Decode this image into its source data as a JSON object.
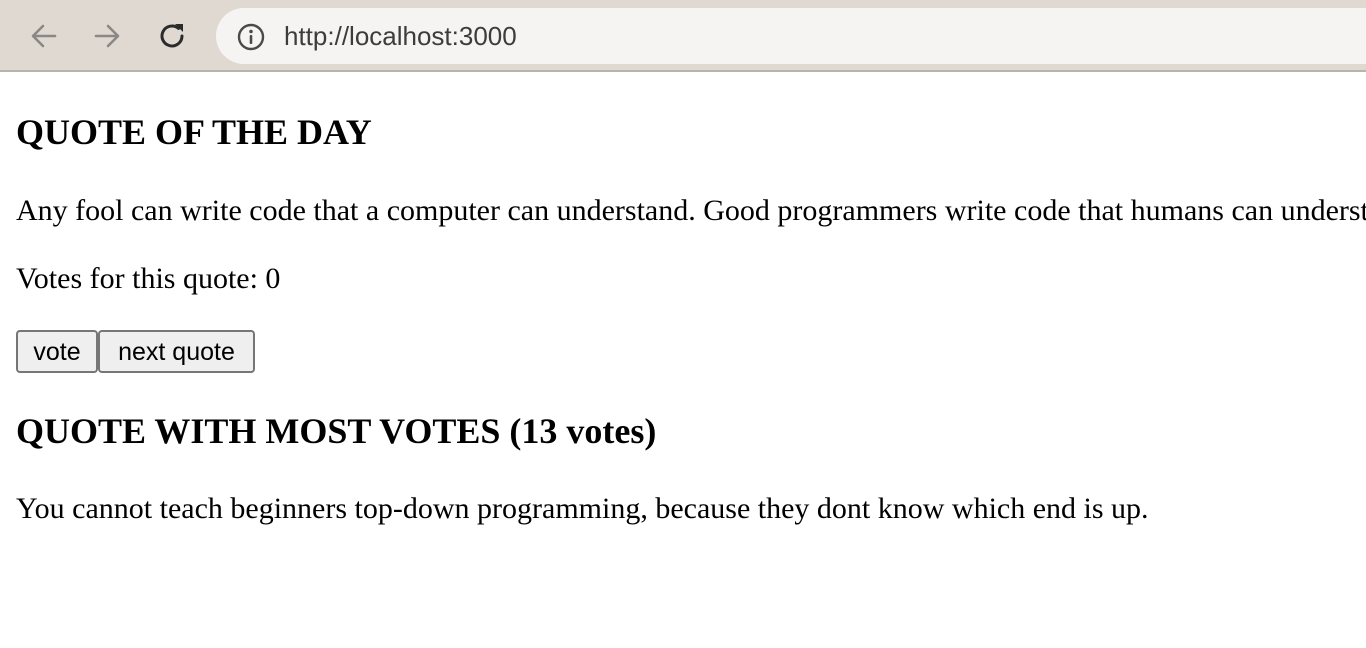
{
  "browser": {
    "url": "http://localhost:3000",
    "icons": {
      "back": "arrow-left-icon",
      "forward": "arrow-right-icon",
      "reload": "reload-icon",
      "info": "info-icon"
    }
  },
  "main": {
    "daily_heading": "QUOTE OF THE DAY",
    "daily_quote": "Any fool can write code that a computer can understand. Good programmers write code that humans can understand.",
    "votes_line": "Votes for this quote: 0",
    "vote_button_label": "vote",
    "next_button_label": "next quote",
    "most_votes_heading": "QUOTE WITH MOST VOTES (13 votes)",
    "most_votes_quote": "You cannot teach beginners top-down programming, because they dont know which end is up."
  },
  "colors": {
    "chrome_background": "#dfd9d2",
    "address_bar_background": "#f6f4f2",
    "button_background": "#efefef",
    "button_border": "#767676"
  }
}
